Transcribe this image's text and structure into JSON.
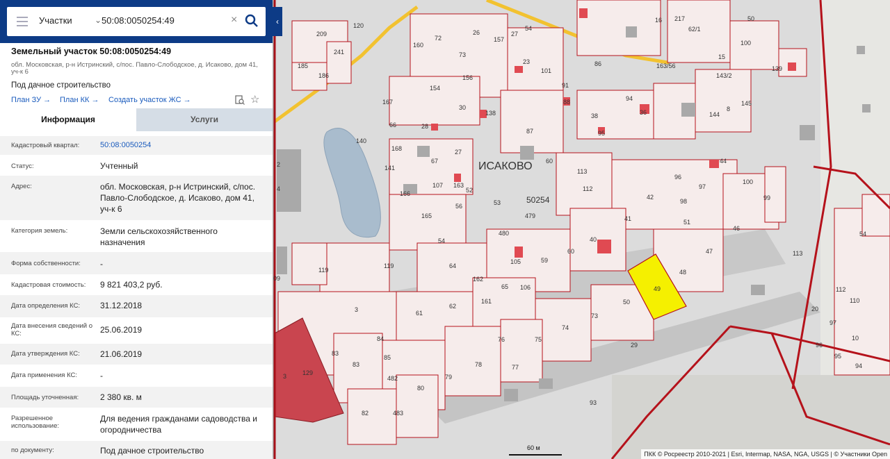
{
  "search": {
    "category": "Участки",
    "query": "50:08:0050254:49"
  },
  "parcel": {
    "title": "Земельный участок 50:08:0050254:49",
    "address_short": "обл. Московская, р-н Истринский, с/пос. Павло-Слободское, д. Исаково, дом 41, уч-к 6",
    "purpose": "Под дачное строительство",
    "links": [
      "План ЗУ",
      "План КК",
      "Создать участок ЖС"
    ]
  },
  "tabs": [
    "Информация",
    "Услуги"
  ],
  "details": [
    {
      "key": "Кадастровый квартал:",
      "value": "50:08:0050254"
    },
    {
      "key": "Статус:",
      "value": "Учтенный"
    },
    {
      "key": "Адрес:",
      "value": "обл. Московская, р-н Истринский, с/пос. Павло-Слободское, д. Исаково, дом 41, уч-к 6"
    },
    {
      "key": "Категория земель:",
      "value": "Земли сельскохозяйственного назначения"
    },
    {
      "key": "Форма собственности:",
      "value": "-"
    },
    {
      "key": "Кадастровая стоимость:",
      "value": "9 821 403,2 руб."
    },
    {
      "key": "Дата определения КС:",
      "value": "31.12.2018"
    },
    {
      "key": "Дата внесения сведений о КС:",
      "value": "25.06.2019"
    },
    {
      "key": "Дата утверждения КС:",
      "value": "21.06.2019"
    },
    {
      "key": "Дата применения КС:",
      "value": "-"
    },
    {
      "key": "Площадь уточненная:",
      "value": "2 380 кв. м"
    },
    {
      "key": "Разрешенное использование:",
      "value": "Для ведения гражданами садоводства и огородничества"
    },
    {
      "key": "по документу:",
      "value": "Под дачное строительство"
    }
  ],
  "map": {
    "village_label": "ИСАКОВО",
    "quarter_label": "50254",
    "selected_parcel_label": "49",
    "selected_color": "#f5f000",
    "boundary_color": "#b5121b",
    "road_color": "#f2c230",
    "parcel_labels": [
      "209",
      "120",
      "185",
      "241",
      "186",
      "160",
      "72",
      "26",
      "73",
      "157",
      "27",
      "54",
      "101",
      "91",
      "86",
      "16",
      "217",
      "62/1",
      "50",
      "36",
      "100",
      "154",
      "23",
      "30",
      "156",
      "138",
      "88",
      "87",
      "95",
      "36",
      "94",
      "144",
      "8",
      "145",
      "139",
      "15",
      "143/2",
      "163/56",
      "167",
      "66",
      "28",
      "27",
      "140",
      "168",
      "67",
      "141",
      "60",
      "113",
      "38",
      "112",
      "44",
      "96",
      "97",
      "100",
      "99",
      "163",
      "52",
      "107",
      "166",
      "165",
      "56",
      "53",
      "479",
      "42",
      "98",
      "41",
      "51",
      "46",
      "480",
      "40",
      "60",
      "59",
      "105",
      "54",
      "113",
      "119",
      "119",
      "64",
      "162",
      "106",
      "65",
      "47",
      "48",
      "50",
      "3",
      "61",
      "62",
      "161",
      "73",
      "74",
      "29",
      "84",
      "85",
      "76",
      "75",
      "83",
      "83",
      "3",
      "129",
      "482",
      "80",
      "79",
      "78",
      "77",
      "82",
      "483",
      "93",
      "20",
      "97",
      "110",
      "112",
      "54",
      "10",
      "95",
      "94",
      "96"
    ],
    "scale_label": "60 м",
    "attribution": "ПКК © Росреестр 2010-2021 | Esri, Intermap, NASA, NGA, USGS | © Участники Open"
  }
}
